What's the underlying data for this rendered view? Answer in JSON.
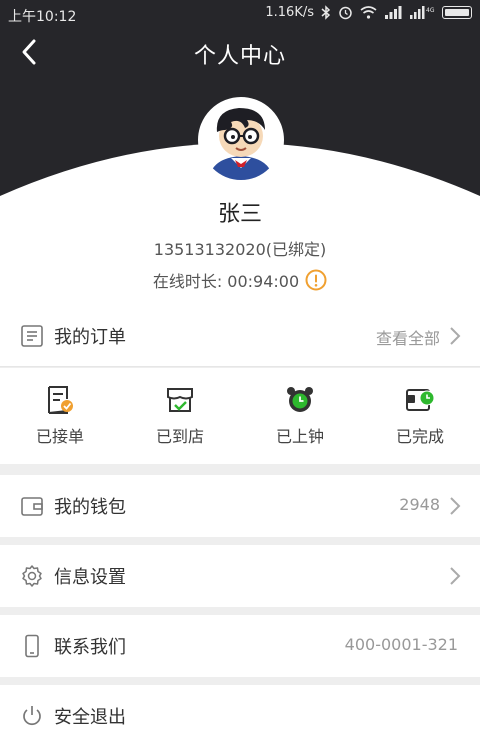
{
  "status_bar": {
    "time": "上午10:12",
    "speed": "1.16K/s",
    "network": "4G"
  },
  "nav": {
    "title": "个人中心"
  },
  "profile": {
    "name": "张三",
    "phone": "13513132020(已绑定)",
    "online_label": "在线时长: 00:94:00"
  },
  "orders": {
    "title": "我的订单",
    "view_all": "查看全部",
    "items": [
      {
        "label": "已接单",
        "icon": "order-accepted-icon"
      },
      {
        "label": "已到店",
        "icon": "store-arrived-icon"
      },
      {
        "label": "已上钟",
        "icon": "alarm-clock-icon"
      },
      {
        "label": "已完成",
        "icon": "wallet-completed-icon"
      }
    ]
  },
  "wallet": {
    "label": "我的钱包",
    "value": "2948"
  },
  "settings": {
    "label": "信息设置"
  },
  "contact": {
    "label": "联系我们",
    "value": "400-0001-321"
  },
  "logout": {
    "label": "安全退出"
  },
  "colors": {
    "header_bg": "#26262a",
    "accent_orange": "#f0a030",
    "accent_green": "#2eb82e"
  }
}
